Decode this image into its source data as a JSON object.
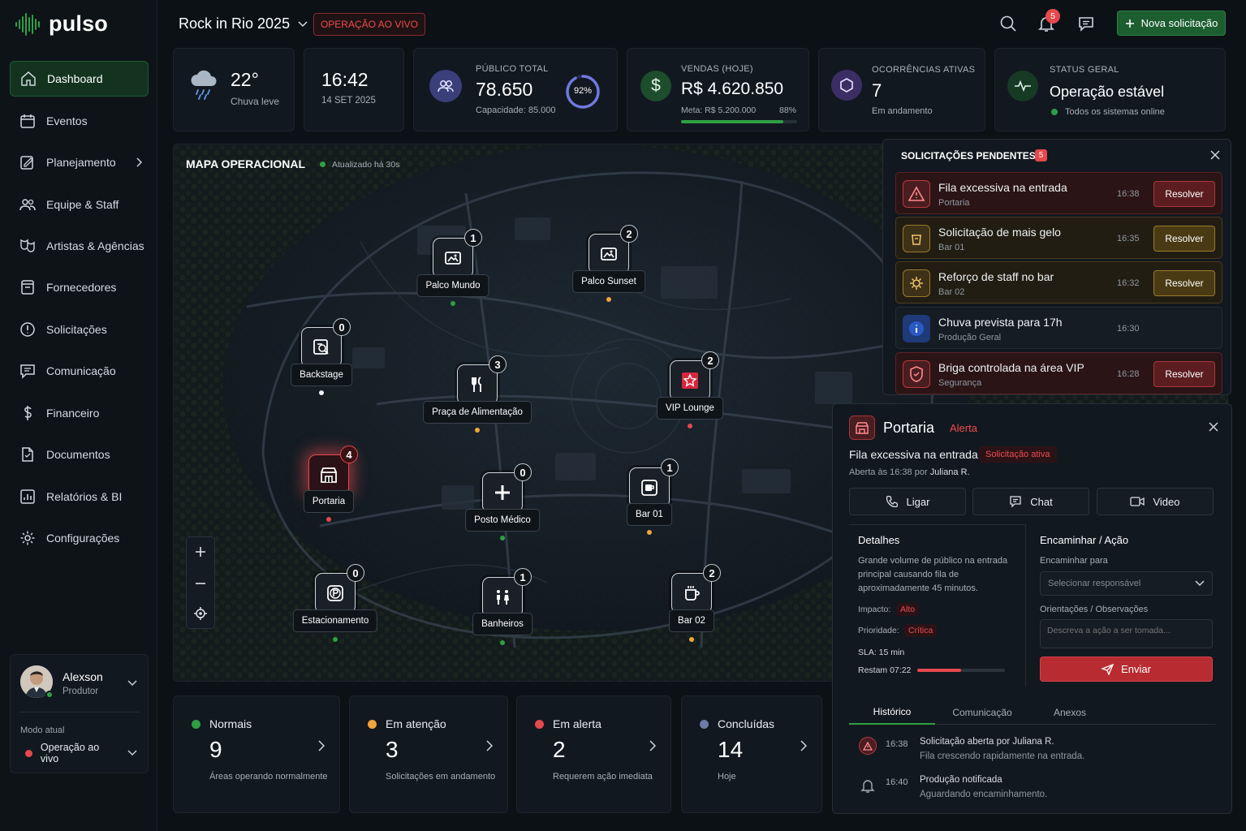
{
  "brand": {
    "name": "pulso",
    "accent": "#2ea043",
    "alert": "#e5484d",
    "warning": "#f0a63a"
  },
  "header": {
    "event_name": "Rock in Rio 2025",
    "live_badge": "OPERAÇÃO AO VIVO",
    "notification_count": "5",
    "new_request_label": "Nova solicitação"
  },
  "sidebar": {
    "items": [
      {
        "label": "Dashboard",
        "icon": "home-icon"
      },
      {
        "label": "Eventos",
        "icon": "calendar-icon"
      },
      {
        "label": "Planejamento",
        "icon": "planning-icon"
      },
      {
        "label": "Equipe & Staff",
        "icon": "team-icon"
      },
      {
        "label": "Artistas & Agências",
        "icon": "masks-icon"
      },
      {
        "label": "Fornecedores",
        "icon": "supplier-icon"
      },
      {
        "label": "Solicitações",
        "icon": "alert-circle-icon"
      },
      {
        "label": "Comunicação",
        "icon": "message-icon"
      },
      {
        "label": "Financeiro",
        "icon": "dollar-icon"
      },
      {
        "label": "Documentos",
        "icon": "document-icon"
      },
      {
        "label": "Relatórios & BI",
        "icon": "report-icon"
      },
      {
        "label": "Configurações",
        "icon": "gear-icon"
      }
    ],
    "user": {
      "name": "Alexson",
      "role": "Produtor"
    },
    "mode_label": "Modo atual",
    "mode_value": "Operação ao vivo"
  },
  "kpis": {
    "weather": {
      "temp": "22°",
      "desc": "Chuva leve"
    },
    "clock": {
      "time": "16:42",
      "date": "14 SET 2025"
    },
    "audience": {
      "label": "PÚBLICO TOTAL",
      "value": "78.650",
      "capacity": "Capacidade: 85.000",
      "percent_label": "92%",
      "percent": 0.92
    },
    "sales": {
      "label": "VENDAS (HOJE)",
      "value": "R$ 4.620.850",
      "goal": "Meta: R$ 5.200.000",
      "percent_label": "88%",
      "percent": 0.88
    },
    "occurrences": {
      "label": "OCORRÊNCIAS ATIVAS",
      "value": "7",
      "sub": "Em andamento"
    },
    "status": {
      "label": "STATUS GERAL",
      "value": "Operação estável",
      "sub": "Todos os sistemas online"
    }
  },
  "map": {
    "title": "MAPA OPERACIONAL",
    "updated": "Atualizado há 30s",
    "locations": [
      {
        "name": "Palco Mundo",
        "count": "1",
        "status": "normal",
        "icon": "stage-icon"
      },
      {
        "name": "Palco Sunset",
        "count": "2",
        "status": "attention",
        "icon": "stage-icon"
      },
      {
        "name": "Backstage",
        "count": "0",
        "status": "neutral",
        "icon": "backstage-icon"
      },
      {
        "name": "Praça de Alimentação",
        "count": "3",
        "status": "attention",
        "icon": "cutlery-icon"
      },
      {
        "name": "VIP Lounge",
        "count": "2",
        "status": "alert",
        "icon": "vip-star-icon"
      },
      {
        "name": "Portaria",
        "count": "4",
        "status": "alert",
        "icon": "gate-icon"
      },
      {
        "name": "Posto Médico",
        "count": "0",
        "status": "normal",
        "icon": "medical-cross-icon"
      },
      {
        "name": "Bar 01",
        "count": "1",
        "status": "attention",
        "icon": "bar-icon"
      },
      {
        "name": "Estacionamento",
        "count": "0",
        "status": "normal",
        "icon": "parking-icon"
      },
      {
        "name": "Banheiros",
        "count": "1",
        "status": "normal",
        "icon": "restroom-icon"
      },
      {
        "name": "Bar 02",
        "count": "2",
        "status": "attention",
        "icon": "cup-icon"
      }
    ]
  },
  "pending": {
    "title": "SOLICITAÇÕES PENDENTES",
    "count": "5",
    "items": [
      {
        "title": "Fila excessiva na entrada",
        "sub": "Portaria",
        "time": "16:38",
        "action": "Resolver"
      },
      {
        "title": "Solicitação de mais gelo",
        "sub": "Bar 01",
        "time": "16:35",
        "action": "Resolver"
      },
      {
        "title": "Reforço de staff no bar",
        "sub": "Bar 02",
        "time": "16:32",
        "action": "Resolver"
      },
      {
        "title": "Chuva prevista para 17h",
        "sub": "Produção Geral",
        "time": "16:30",
        "action": ""
      },
      {
        "title": "Briga controlada na área VIP",
        "sub": "Segurança",
        "time": "16:28",
        "action": "Resolver"
      }
    ]
  },
  "detail": {
    "location": "Portaria",
    "level": "Alerta",
    "issue": "Fila excessiva na entrada",
    "issue_badge": "Solicitação ativa",
    "opened_prefix": "Aberta às 16:38 por ",
    "opened_by": "Juliana R.",
    "actions": [
      "Ligar",
      "Chat",
      "Video"
    ],
    "details_title": "Detalhes",
    "details_text": "Grande volume de público na entrada principal causando fila de aproximadamente 45 minutos.",
    "impact_label": "Impacto:",
    "impact_value": "Alto",
    "priority_label": "Prioridade:",
    "priority_value": "Crítica",
    "sla": "SLA: 15 min",
    "remaining": "Restam 07:22",
    "remaining_fraction": 0.5,
    "forward_title": "Encaminhar / Ação",
    "forward_label": "Encaminhar para",
    "forward_placeholder": "Selecionar responsável",
    "notes_label": "Orientações / Observações",
    "notes_placeholder": "Descreva a ação a ser tomada...",
    "send_label": "Enviar",
    "tabs": [
      "Histórico",
      "Comunicação",
      "Anexos"
    ],
    "history": [
      {
        "time": "16:38",
        "title": "Solicitação aberta por Juliana R.",
        "sub": "Fila crescendo rapidamente na entrada."
      },
      {
        "time": "16:40",
        "title": "Produção notificada",
        "sub": "Aguardando encaminhamento."
      }
    ]
  },
  "summary": [
    {
      "title": "Normais",
      "value": "9",
      "sub": "Áreas operando normalmente",
      "color": "#2ea043"
    },
    {
      "title": "Em atenção",
      "value": "3",
      "sub": "Solicitações em andamento",
      "color": "#f0a63a"
    },
    {
      "title": "Em alerta",
      "value": "2",
      "sub": "Requerem ação imediata",
      "color": "#e5484d"
    },
    {
      "title": "Concluídas",
      "value": "14",
      "sub": "Hoje",
      "color": "#6b7aa6"
    }
  ]
}
